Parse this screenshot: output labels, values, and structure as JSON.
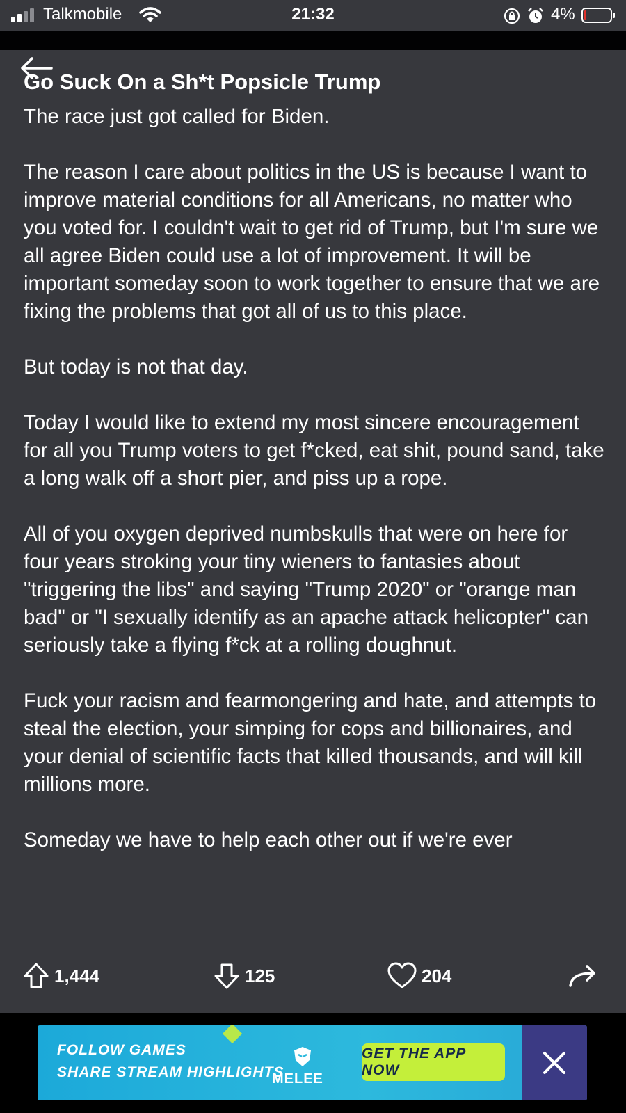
{
  "status_bar": {
    "carrier": "Talkmobile",
    "time": "21:32",
    "battery_percent": "4%"
  },
  "post": {
    "title": "Go Suck On a Sh*t Popsicle Trump",
    "paragraphs": [
      "The race just got called for Biden.",
      "The reason I care about politics in the US is because I want to improve material conditions for all Americans, no matter who you voted for. I couldn't wait to get rid of Trump, but I'm sure we all agree Biden could use a lot of improvement. It will be important someday soon to work together to ensure that we are fixing the problems that got all of us to this place.",
      "But today is not that day.",
      "Today I would like to extend my most sincere encouragement for all you Trump voters to get f*cked, eat shit, pound sand, take a long walk off a short pier, and piss up a rope.",
      "All of you oxygen deprived numbskulls that were on here for four years stroking your tiny wieners to fantasies about \"triggering the libs\" and saying \"Trump 2020\" or \"orange man bad\" or \"I sexually identify as an apache attack helicopter\" can seriously take a flying f*ck at a rolling doughnut.",
      "Fuck your racism and fearmongering and hate, and attempts to steal the election, your simping for cops and billionaires, and your denial of scientific facts that killed thousands, and will kill millions more.",
      "Someday we have to help each other out if we're ever"
    ]
  },
  "actions": {
    "upvotes": "1,444",
    "downvotes": "125",
    "likes": "204"
  },
  "ad": {
    "headline_1": "FOLLOW GAMES",
    "headline_2": "SHARE STREAM HIGHLIGHTS",
    "brand": "MELEE",
    "cta": "GET THE APP NOW"
  },
  "colors": {
    "background": "#37383d",
    "ad_blue": "#2db9dd",
    "cta_green": "#c4ef3a",
    "close_purple": "#3b3a84",
    "battery_low": "#e0322c"
  }
}
